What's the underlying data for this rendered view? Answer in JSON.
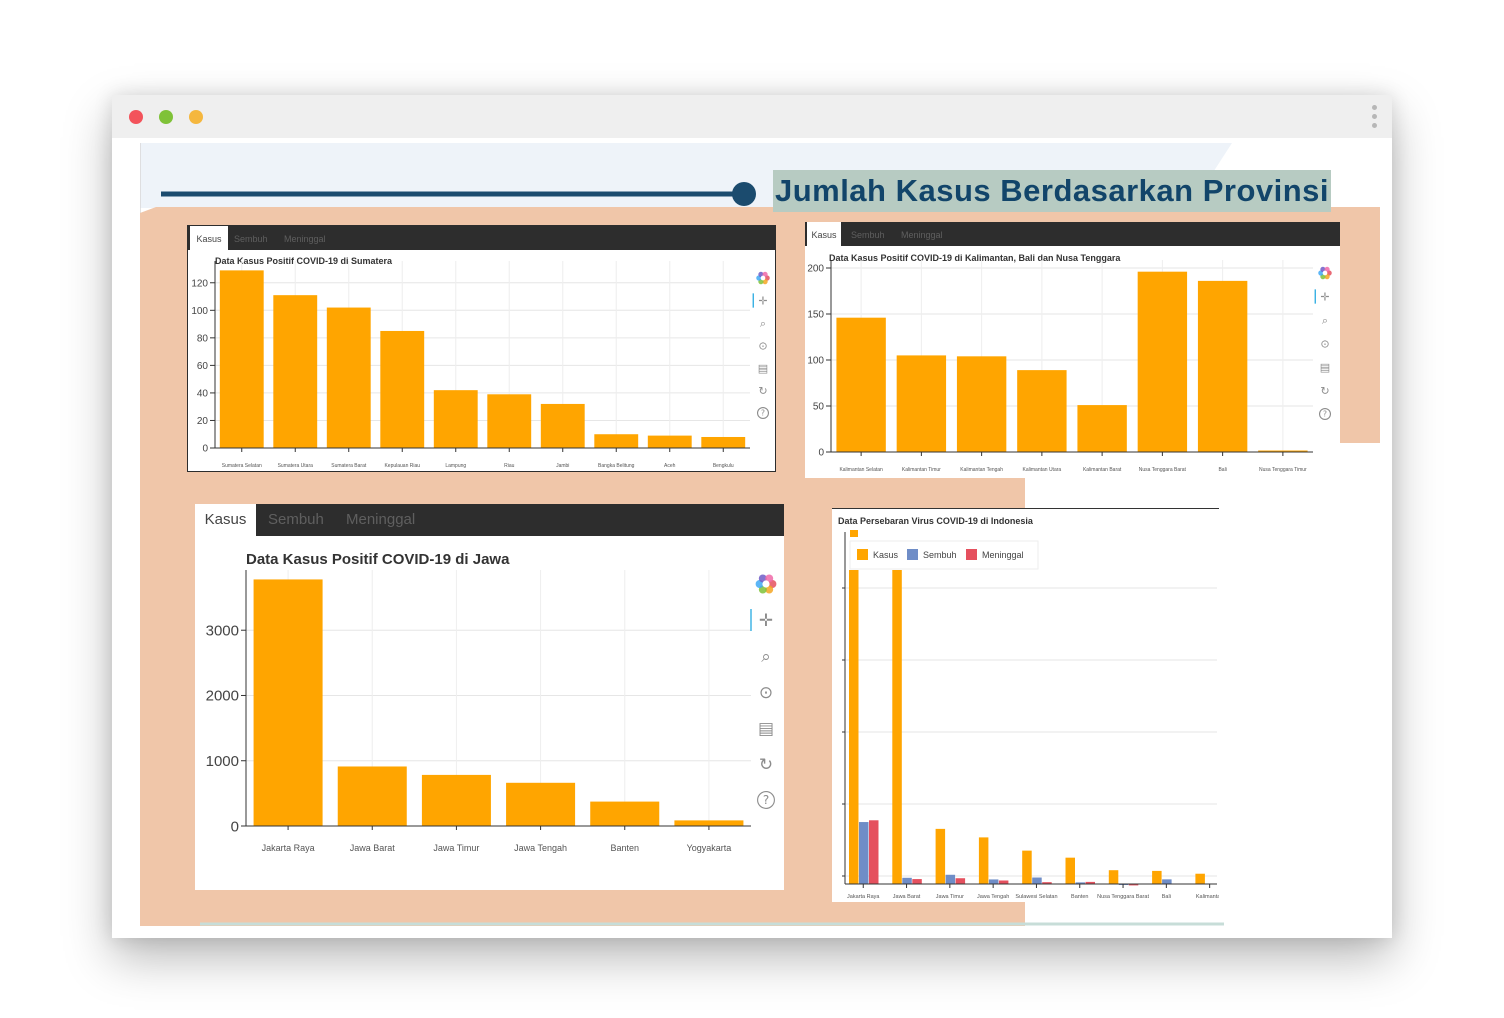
{
  "page": {
    "headline": "Jumlah Kasus Berdasarkan Provinsi"
  },
  "colors": {
    "accent": "#ffa500",
    "sembuh": "#6f8dc7",
    "meninggal": "#e5505e",
    "panel_bg": "#f0c6a9",
    "navy": "#1b4b6e",
    "headline_bg": "#b7cbc2"
  },
  "panels": {
    "sumatera": {
      "tabs": [
        "Kasus",
        "Sembuh",
        "Meninggal"
      ],
      "active_tab": "Kasus"
    },
    "kalimantan": {
      "tabs": [
        "Kasus",
        "Sembuh",
        "Meninggal"
      ],
      "active_tab": "Kasus"
    },
    "jawa": {
      "tabs": [
        "Kasus",
        "Sembuh",
        "Meninggal"
      ],
      "active_tab": "Kasus"
    }
  },
  "toolbar_icons": [
    "bokeh-logo-icon",
    "pan-icon",
    "box-zoom-icon",
    "wheel-zoom-icon",
    "save-icon",
    "reset-icon",
    "help-icon"
  ],
  "chart_data": [
    {
      "type": "bar",
      "title": "Data Kasus Positif COVID-19 di Sumatera",
      "categories": [
        "Sumatera Selatan",
        "Sumatera Utara",
        "Sumatera Barat",
        "Kepulauan Riau",
        "Lampung",
        "Riau",
        "Jambi",
        "Bangka Belitung",
        "Aceh",
        "Bengkulu"
      ],
      "values": [
        129,
        111,
        102,
        85,
        42,
        39,
        32,
        10,
        9,
        8
      ],
      "ylim": [
        0,
        130
      ],
      "yticks": [
        0,
        20,
        40,
        60,
        80,
        100,
        120
      ],
      "grid": true
    },
    {
      "type": "bar",
      "title": "Data Kasus Positif COVID-19 di Kalimantan, Bali dan Nusa Tenggara",
      "categories": [
        "Kalimantan Selatan",
        "Kalimantan Timur",
        "Kalimantan Tengah",
        "Kalimantan Utara",
        "Kalimantan Barat",
        "Nusa Tenggara Barat",
        "Bali",
        "Nusa Tenggara Timur"
      ],
      "values": [
        146,
        105,
        104,
        89,
        51,
        196,
        186,
        1
      ],
      "ylim": [
        0,
        200
      ],
      "yticks": [
        0,
        50,
        100,
        150,
        200
      ],
      "grid": true
    },
    {
      "type": "bar",
      "title": "Data Kasus Positif COVID-19 di Jawa",
      "categories": [
        "Jakarta Raya",
        "Jawa Barat",
        "Jawa Timur",
        "Jawa Tengah",
        "Banten",
        "Yogyakarta"
      ],
      "values": [
        3778,
        912,
        783,
        662,
        374,
        86
      ],
      "ylim": [
        0,
        3800
      ],
      "yticks": [
        0,
        1000,
        2000,
        3000
      ],
      "grid": true
    },
    {
      "type": "bar",
      "title": "Data Persebaran Virus COVID-19 di Indonesia",
      "categories": [
        "Jakarta Raya",
        "Jawa Barat",
        "Jawa Timur",
        "Jawa Tengah",
        "Sulawesi Selatan",
        "Banten",
        "Nusa Tenggara Barat",
        "Bali",
        "Kalimantan"
      ],
      "series": [
        {
          "name": "Kasus",
          "values": [
            3778,
            912,
            783,
            662,
            474,
            374,
            196,
            186,
            146
          ]
        },
        {
          "name": "Sembuh",
          "values": [
            880,
            88,
            131,
            65,
            92,
            23,
            7,
            66,
            0
          ]
        },
        {
          "name": "Meninggal",
          "values": [
            905,
            70,
            82,
            50,
            26,
            30,
            1,
            0,
            0
          ]
        }
      ],
      "legend": "top-left",
      "grid": true
    }
  ]
}
